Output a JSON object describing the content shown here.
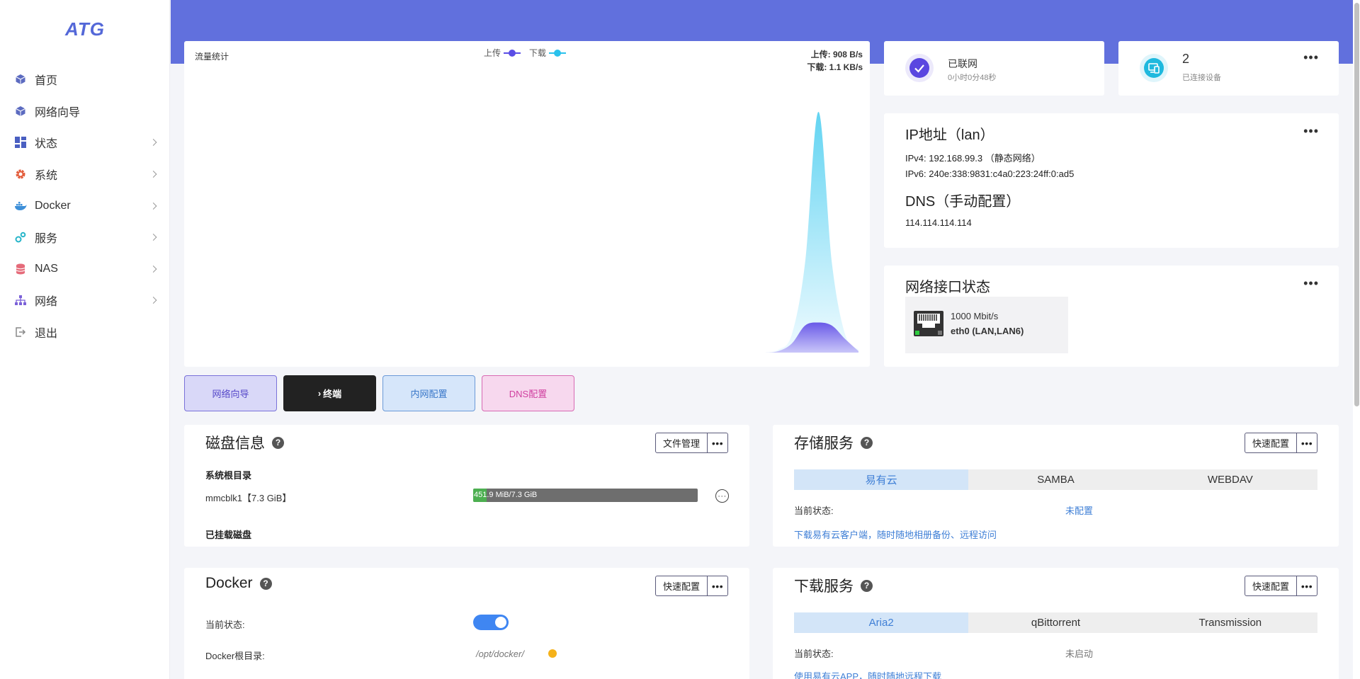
{
  "brand": {
    "logo_text": "ATG",
    "accent": "#6170dd"
  },
  "sidebar": {
    "items": [
      {
        "label": "首页",
        "icon": "cube-icon",
        "has_submenu": false
      },
      {
        "label": "网络向导",
        "icon": "cube-icon",
        "has_submenu": false
      },
      {
        "label": "状态",
        "icon": "dashboard-icon",
        "has_submenu": true
      },
      {
        "label": "系统",
        "icon": "gear-icon",
        "has_submenu": true
      },
      {
        "label": "Docker",
        "icon": "docker-icon",
        "has_submenu": true
      },
      {
        "label": "服务",
        "icon": "services-icon",
        "has_submenu": true
      },
      {
        "label": "NAS",
        "icon": "database-icon",
        "has_submenu": true
      },
      {
        "label": "网络",
        "icon": "network-icon",
        "has_submenu": true
      },
      {
        "label": "退出",
        "icon": "logout-icon",
        "has_submenu": false
      }
    ]
  },
  "traffic": {
    "title": "流量统计",
    "legend_upload": "上传",
    "legend_download": "下载",
    "upload_rate": "上传: 908 B/s",
    "download_rate": "下载: 1.1 KB/s",
    "upload_color": "#5b4ee6",
    "download_color": "#29c1ec"
  },
  "chart_data": {
    "type": "area",
    "title": "流量统计",
    "series": [
      {
        "name": "上传",
        "values": [
          0,
          0,
          0,
          0,
          0,
          0,
          0,
          0,
          0,
          0,
          0,
          0,
          0,
          0,
          0,
          0,
          0,
          0,
          0,
          0,
          0,
          0,
          0,
          0,
          0,
          0,
          0,
          0,
          0,
          0,
          0,
          0,
          0,
          0,
          0,
          0,
          0,
          0,
          0,
          0,
          0,
          0,
          0,
          0,
          0.05,
          0.3,
          0.9,
          1.0,
          0.9,
          0.45,
          0.05
        ]
      },
      {
        "name": "下载",
        "values": [
          0,
          0,
          0,
          0,
          0,
          0,
          0,
          0,
          0,
          0,
          0,
          0,
          0,
          0,
          0,
          0,
          0,
          0,
          0,
          0,
          0,
          0,
          0,
          0,
          0,
          0,
          0,
          0,
          0,
          0,
          0,
          0,
          0,
          0,
          0,
          0,
          0,
          0,
          0,
          0,
          0,
          0,
          0,
          0,
          0.1,
          0.6,
          3.0,
          8.0,
          3.0,
          0.6,
          0.1
        ]
      }
    ]
  },
  "network": {
    "status": "已联网",
    "uptime": "0小时0分48秒"
  },
  "devices": {
    "count": "2",
    "label": "已连接设备"
  },
  "ip": {
    "title": "IP地址（lan）",
    "ipv4": "IPv4: 192.168.99.3 （静态网络）",
    "ipv6": "IPv6: 240e:338:9831:c4a0:223:24ff:0:ad5",
    "dns_title": "DNS（手动配置）",
    "dns": "114.114.114.114"
  },
  "interfaces": {
    "title": "网络接口状态",
    "speed": "1000 Mbit/s",
    "name": "eth0 (LAN,LAN6)"
  },
  "quick_buttons": [
    "网络向导",
    "终端",
    "内网配置",
    "DNS配置"
  ],
  "disk": {
    "title": "磁盘信息",
    "button": "文件管理",
    "root_label": "系统根目录",
    "device": "mmcblk1【7.3 GiB】",
    "usage_text": "451.9 MiB/7.3 GiB",
    "usage_fraction": 0.06,
    "mounted_label": "已挂载磁盘"
  },
  "storage": {
    "title": "存储服务",
    "button": "快速配置",
    "tabs": [
      "易有云",
      "SAMBA",
      "WEBDAV"
    ],
    "status_key": "当前状态:",
    "status_value": "未配置",
    "link": "下载易有云客户端，随时随地相册备份、远程访问"
  },
  "docker": {
    "title": "Docker",
    "button": "快速配置",
    "status_key": "当前状态:",
    "enabled": true,
    "root_key": "Docker根目录:",
    "root_value": "/opt/docker/"
  },
  "download": {
    "title": "下载服务",
    "button": "快速配置",
    "tabs": [
      "Aria2",
      "qBittorrent",
      "Transmission"
    ],
    "status_key": "当前状态:",
    "status_value": "未启动",
    "link": "使用易有云APP，随时随地远程下载"
  }
}
